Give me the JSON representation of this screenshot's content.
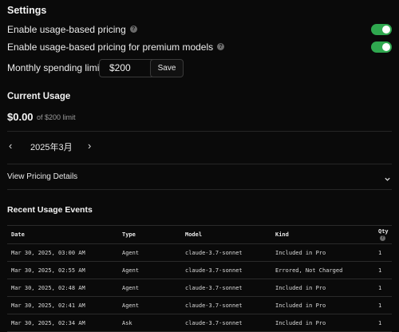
{
  "settings": {
    "title": "Settings",
    "usage_pricing_label": "Enable usage-based pricing",
    "usage_pricing_enabled": true,
    "premium_pricing_label": "Enable usage-based pricing for premium models",
    "premium_pricing_enabled": true,
    "limit_label": "Monthly spending limit:",
    "limit_value": "$200",
    "save_label": "Save",
    "help_glyph": "?",
    "toggle_on_color": "#2fa84f"
  },
  "current_usage": {
    "title": "Current Usage",
    "amount": "$0.00",
    "of_limit": "of $200 limit",
    "month": "2025年3月",
    "prev_glyph": "‹",
    "next_glyph": "›"
  },
  "pricing_details": {
    "label": "View Pricing Details",
    "chevron_icon": "chevron-down-icon"
  },
  "recent_events": {
    "title": "Recent Usage Events",
    "columns": [
      "Date",
      "Type",
      "Model",
      "Kind",
      "Qty"
    ],
    "qty_help_glyph": "?",
    "rows": [
      [
        "Mar 30, 2025, 03:00 AM",
        "Agent",
        "claude-3.7-sonnet",
        "Included in Pro",
        "1"
      ],
      [
        "Mar 30, 2025, 02:55 AM",
        "Agent",
        "claude-3.7-sonnet",
        "Errored, Not Charged",
        "1"
      ],
      [
        "Mar 30, 2025, 02:48 AM",
        "Agent",
        "claude-3.7-sonnet",
        "Included in Pro",
        "1"
      ],
      [
        "Mar 30, 2025, 02:41 AM",
        "Agent",
        "claude-3.7-sonnet",
        "Included in Pro",
        "1"
      ],
      [
        "Mar 30, 2025, 02:34 AM",
        "Ask",
        "claude-3.7-sonnet",
        "Included in Pro",
        "1"
      ]
    ]
  }
}
